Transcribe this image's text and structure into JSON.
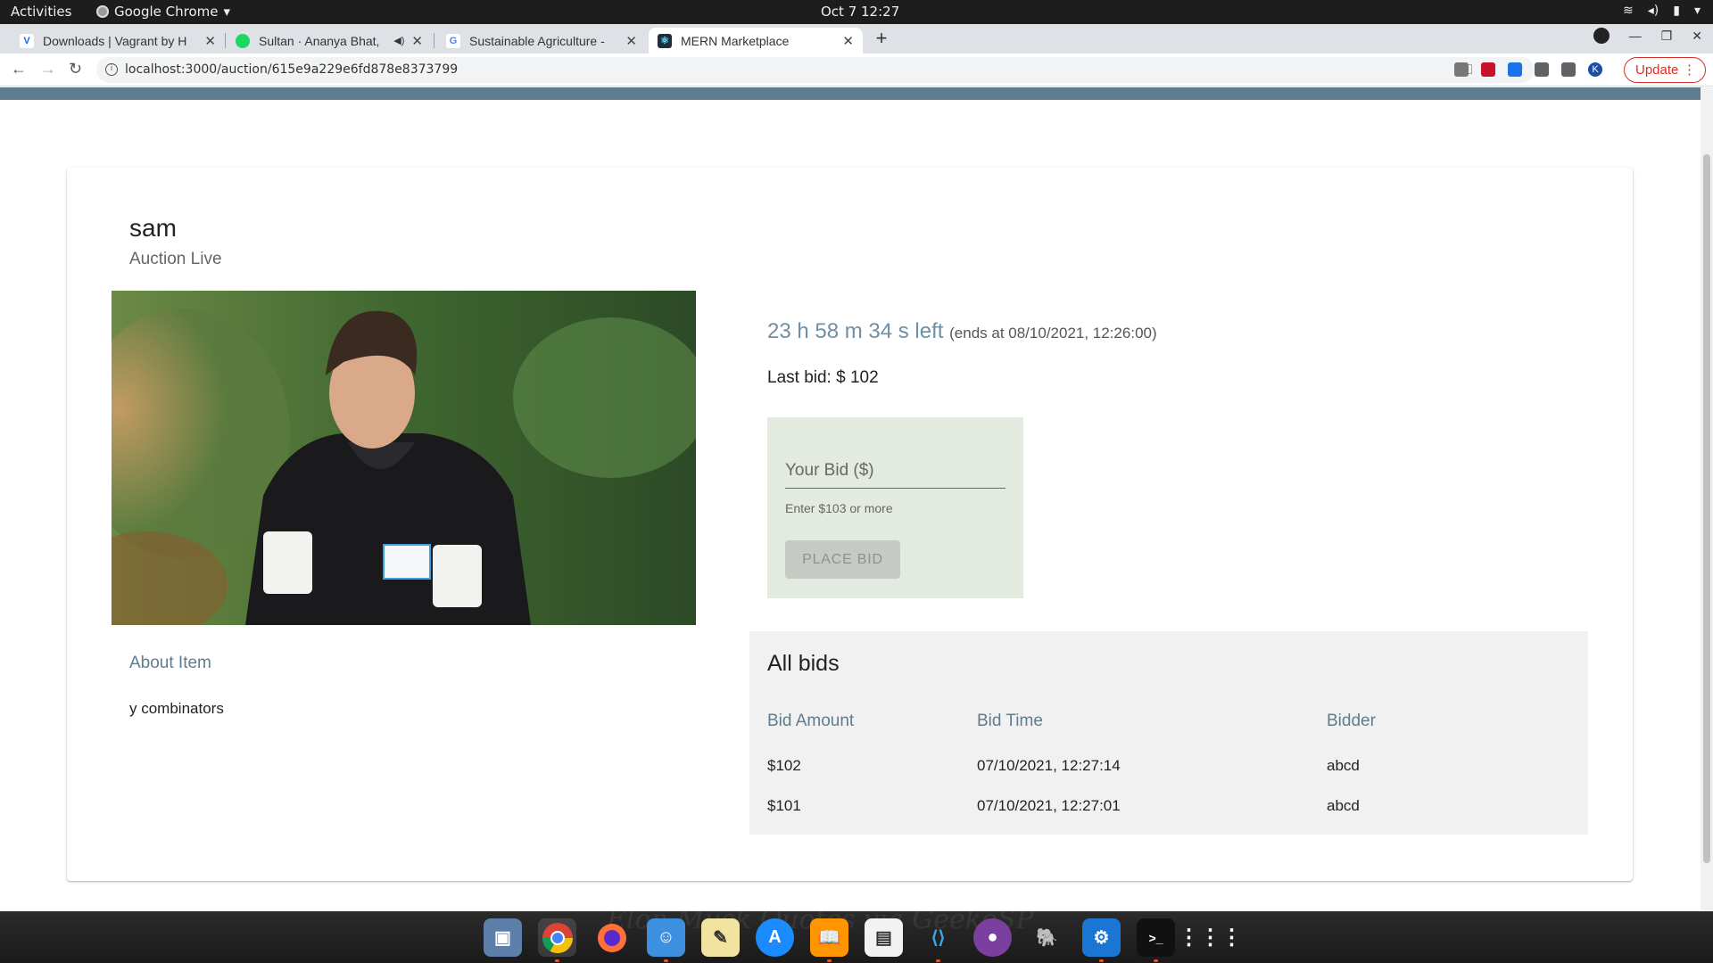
{
  "system_bar": {
    "activities": "Activities",
    "app_name": "Google Chrome",
    "clock": "Oct 7  12:27"
  },
  "tabs": [
    {
      "title": "Downloads | Vagrant by H",
      "favicon_color": "#1563ff",
      "favicon_glyph": "V"
    },
    {
      "title": "Sultan · Ananya Bhat, ",
      "favicon_color": "#1ed760",
      "favicon_glyph": ""
    },
    {
      "title": "Sustainable Agriculture - ",
      "favicon_color": "#ffffff",
      "favicon_glyph": "G"
    },
    {
      "title": "MERN Marketplace",
      "favicon_color": "#1b2e3b",
      "favicon_glyph": "⚛"
    }
  ],
  "address_bar": {
    "url": "localhost:3000/auction/615e9a229e6fd878e8373799",
    "profile_initial": "K",
    "update_label": "Update"
  },
  "auction": {
    "item_name": "sam",
    "status": "Auction Live",
    "about_heading": "About Item",
    "about_text": "y combinators",
    "time_left": "23 h 58 m 34 s left",
    "ends_at": "(ends at 08/10/2021, 12:26:00)",
    "last_bid": "Last bid: $ 102",
    "bid_input_placeholder": "Your Bid ($)",
    "bid_helper": "Enter $103 or more",
    "place_bid_label": "PLACE BID"
  },
  "bids_table": {
    "title": "All bids",
    "columns": [
      "Bid Amount",
      "Bid Time",
      "Bidder"
    ],
    "rows": [
      {
        "amount": "$102",
        "time": "07/10/2021, 12:27:14",
        "bidder": "abcd"
      },
      {
        "amount": "$101",
        "time": "07/10/2021, 12:27:01",
        "bidder": "abcd"
      }
    ]
  },
  "colors": {
    "accent": "#5f7d8e",
    "bid_box_bg": "#e3ebe1",
    "bids_bg": "#f1f1f1",
    "update_red": "#d93025"
  },
  "dock": {
    "watermark": "Elon Musk Quotes via GeekoSP",
    "apps": [
      "shotwell-icon",
      "chrome-icon",
      "firefox-icon",
      "files-icon",
      "notes-icon",
      "app-store-icon",
      "books-icon",
      "text-editor-icon",
      "vscode-icon",
      "github-icon",
      "postgres-icon",
      "monitor-icon",
      "terminal-icon",
      "app-grid-icon"
    ]
  }
}
